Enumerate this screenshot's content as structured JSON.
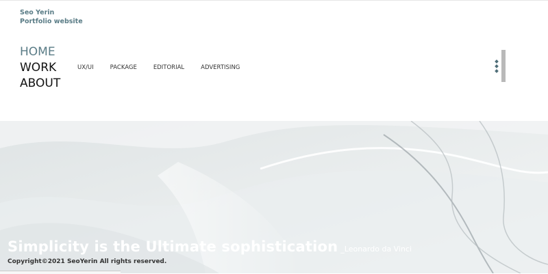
{
  "brand": {
    "name": "Seo Yerin",
    "subtitle": "Portfolio website"
  },
  "main_nav": [
    {
      "label": "HOME",
      "active": true
    },
    {
      "label": "WORK",
      "active": false
    },
    {
      "label": "ABOUT",
      "active": false
    }
  ],
  "sub_nav": [
    "UX/UI",
    "PACKAGE",
    "EDITORIAL",
    "ADVERTISING"
  ],
  "menu_button": {
    "icon": "three-dots-icon"
  },
  "hero": {
    "quote": "Simplicity is the Ultimate sophistication",
    "author": "_Leonardo da Vinci"
  },
  "footer": {
    "copyright": "Copyright©2021 SeoYerin All rights reserved."
  },
  "colors": {
    "accent": "#5a7c86",
    "text": "#111111"
  }
}
